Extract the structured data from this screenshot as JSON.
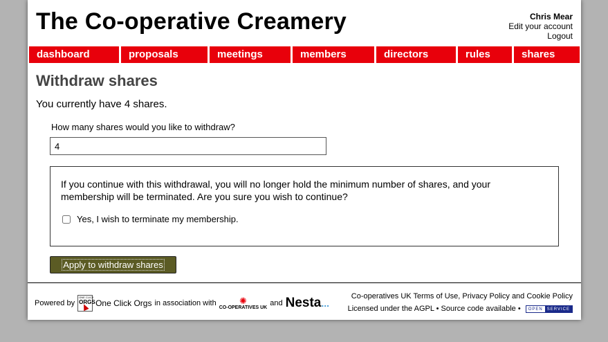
{
  "header": {
    "site_title": "The Co-operative Creamery",
    "user_name": "Chris Mear",
    "edit_account_link": "Edit your account",
    "logout_link": "Logout"
  },
  "nav": {
    "tabs": [
      {
        "label": "dashboard"
      },
      {
        "label": "proposals"
      },
      {
        "label": "meetings"
      },
      {
        "label": "members"
      },
      {
        "label": "directors"
      },
      {
        "label": "rules"
      },
      {
        "label": "shares"
      }
    ],
    "color": "#e8000b"
  },
  "main": {
    "page_title": "Withdraw shares",
    "current_shares_text": "You currently have 4 shares.",
    "quantity_label": "How many shares would you like to withdraw?",
    "quantity_value": "4",
    "warning_text": "If you continue with this withdrawal, you will no longer hold the minimum number of shares, and your membership will be terminated. Are you sure you wish to continue?",
    "confirm_label": "Yes, I wish to terminate my membership.",
    "confirm_checked": false,
    "submit_label": "Apply to withdraw shares",
    "submit_color": "#5b5b24"
  },
  "footer": {
    "powered_by": "Powered by",
    "oco_logo_small": "ONE CLICK",
    "oco_logo_big": "ORGS",
    "oco_name": "One Click Orgs",
    "association_text": "in association with",
    "coop_logo_text": "CO-OPERATIVES UK",
    "and_text": "and",
    "nesta_logo_text": "Nesta",
    "nesta_dots": "...",
    "coop_uk": "Co-operatives UK",
    "terms_link": "Terms of Use",
    "comma": ",",
    "privacy_link": "Privacy Policy",
    "and_word": "and",
    "cookie_link": "Cookie Policy",
    "licence_text": "Licensed under the AGPL • Source code available •",
    "badge_open": "OPEN",
    "badge_service": "SERVICE"
  }
}
